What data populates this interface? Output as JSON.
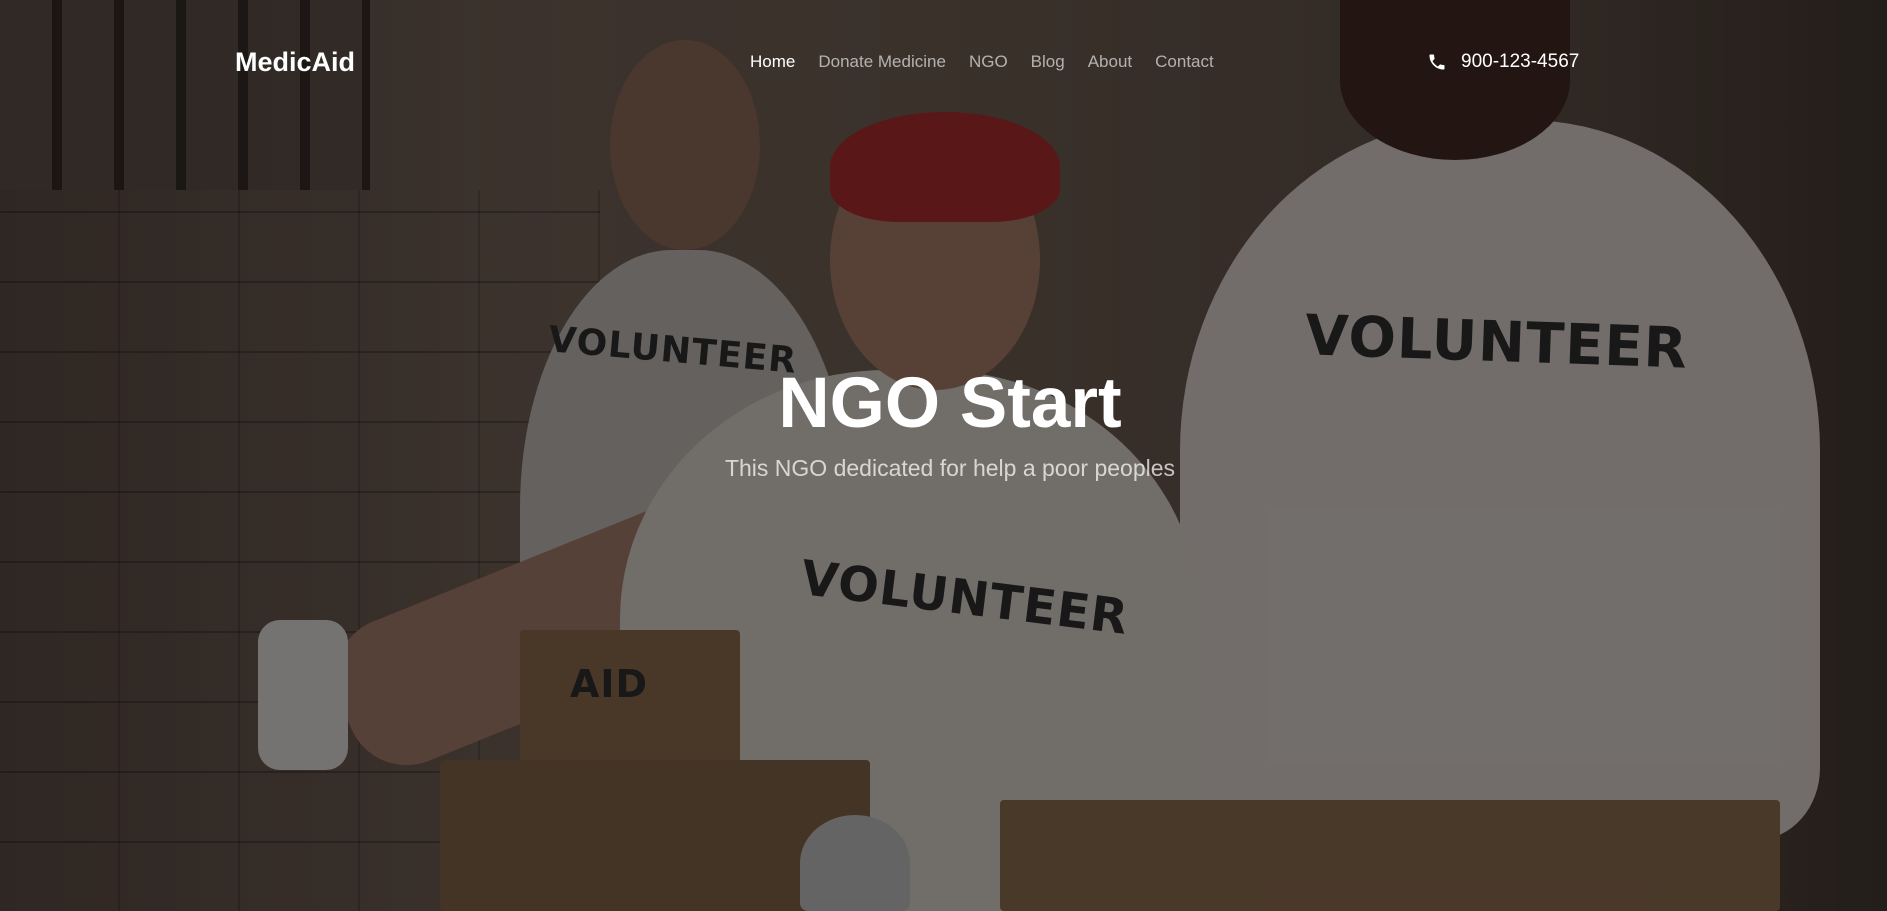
{
  "navbar": {
    "brand": "MedicAid",
    "items": [
      {
        "label": "Home",
        "active": true
      },
      {
        "label": "Donate Medicine",
        "active": false
      },
      {
        "label": "NGO",
        "active": false
      },
      {
        "label": "Blog",
        "active": false
      },
      {
        "label": "About",
        "active": false
      },
      {
        "label": "Contact",
        "active": false
      }
    ],
    "phone_icon": "phone-icon",
    "phone": "900-123-4567"
  },
  "hero": {
    "title": "NGO Start",
    "subtitle": "This NGO dedicated for help a poor peoples",
    "background_image": {
      "texts": [
        "VOLUNTEER",
        "VOLUNTEER",
        "VOLUNTEER",
        "AID"
      ]
    }
  },
  "colors": {
    "nav_active": "#ffffff",
    "nav_inactive": "#b8b3ae",
    "overlay": "#2a2320"
  }
}
